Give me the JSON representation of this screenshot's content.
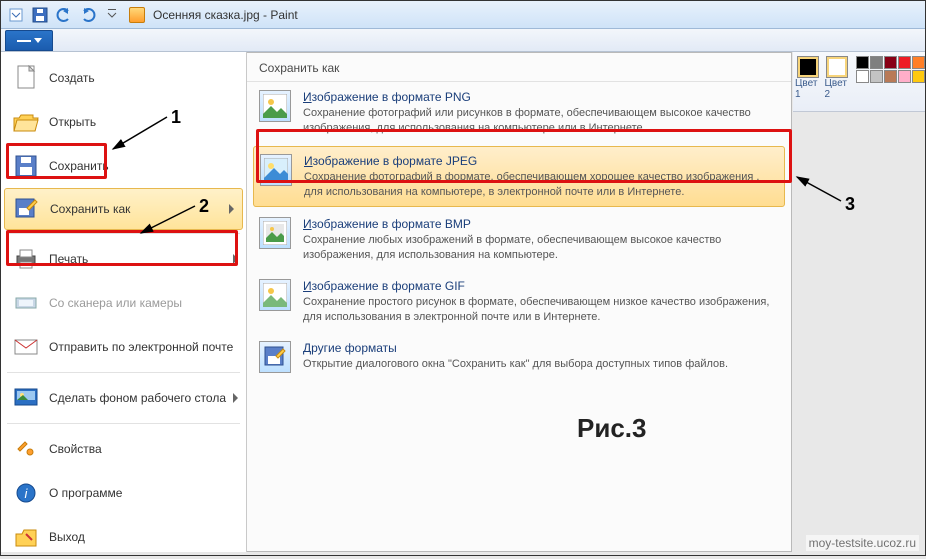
{
  "window": {
    "title": "Осенняя сказка.jpg - Paint"
  },
  "left_menu": {
    "new": "Создать",
    "open": "Открыть",
    "save": "Сохранить",
    "save_as": "Сохранить как",
    "print": "Печать",
    "scanner": "Со сканера или камеры",
    "email": "Отправить по электронной почте",
    "wallpaper": "Сделать фоном рабочего стола",
    "properties": "Свойства",
    "about": "О программе",
    "exit": "Выход"
  },
  "submenu": {
    "title": "Сохранить как",
    "png": {
      "title_pre": "И",
      "title_rest": "зображение в формате PNG",
      "desc": "Сохранение фотографий или рисунков в формате, обеспечивающем высокое качество изображения, для использования на компьютере или в Интернете."
    },
    "jpeg": {
      "title_pre": "И",
      "title_rest": "зображение в формате JPEG",
      "desc": "Сохранение фотографий в формате, обеспечивающем хорошее качество изображения , для использования на компьютере, в электронной почте или в Интернете."
    },
    "bmp": {
      "title_pre": "И",
      "title_rest": "зображение в формате BMP",
      "desc": "Сохранение любых изображений в формате, обеспечивающем высокое качество изображения, для использования на компьютере."
    },
    "gif": {
      "title_pre": "И",
      "title_rest": "зображение в формате GIF",
      "desc": "Сохранение простого рисунок в формате, обеспечивающем низкое качество изображения, для использования в электронной почте или в Интернете."
    },
    "other": {
      "title_pre": "Д",
      "title_rest": "ругие форматы",
      "desc": "Открытие диалогового окна \"Сохранить как\" для выбора доступных типов файлов."
    }
  },
  "annotations": {
    "n1": "1",
    "n2": "2",
    "n3": "3",
    "figure": "Рис.3"
  },
  "colors": {
    "c1": "Цвет 1",
    "c2": "Цвет 2"
  },
  "palette": [
    "#000",
    "#7f7f7f",
    "#880015",
    "#ed1c24",
    "#ff7f27",
    "#fff",
    "#c3c3c3",
    "#b97a57",
    "#ffaec9",
    "#ffc90e"
  ],
  "watermark": "moy-testsite.ucoz.ru"
}
